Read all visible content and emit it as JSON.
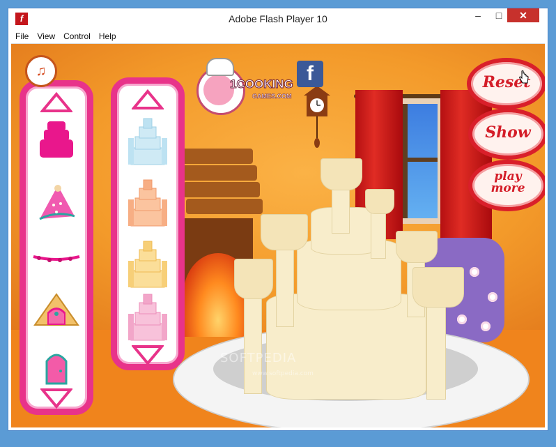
{
  "window": {
    "title": "Adobe Flash Player 10",
    "app_icon": "f",
    "min_label": "–",
    "max_label": "□",
    "close_label": "✕"
  },
  "menu": {
    "items": [
      "File",
      "View",
      "Control",
      "Help"
    ]
  },
  "game": {
    "logo": {
      "line1": "1COOKING",
      "line2": "GAMES",
      "line3": ".COM"
    },
    "facebook_label": "f",
    "buttons": {
      "reset": "Reset",
      "show": "Show",
      "play_more_line1": "play",
      "play_more_line2": "more"
    },
    "watermark": "SOFTPEDIA",
    "watermark_small": "www.softpedia.com",
    "left_panel_items": [
      "pink-cake-base",
      "princess-hat-topper",
      "pink-bead-garland",
      "brick-gate-decoration",
      "pink-door"
    ],
    "right_panel_items": [
      "blue-castle-cake",
      "orange-castle-cake",
      "yellow-castle-cake",
      "pink-castle-cake"
    ],
    "colors": {
      "panel_border": "#e8338a",
      "button_border": "#d91f2a",
      "wall": "#f39a2a",
      "cake": "#f8edcb"
    }
  }
}
